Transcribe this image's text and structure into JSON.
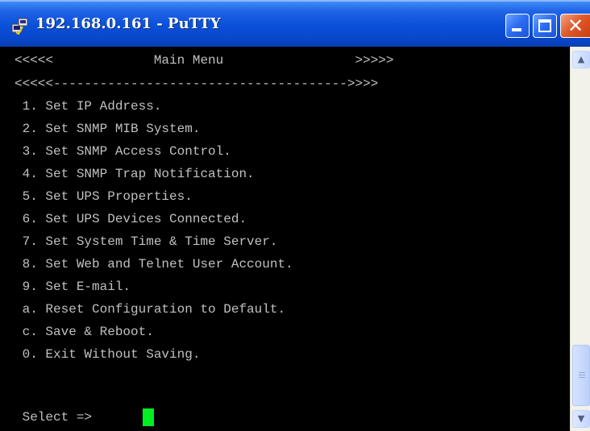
{
  "window": {
    "title": "192.168.0.161 - PuTTY",
    "icon": "putty-icon",
    "controls": {
      "minimize": "minimize-icon",
      "maximize": "maximize-icon",
      "close": "✕"
    }
  },
  "terminal": {
    "header": "<<<<<             Main Menu                 >>>>>",
    "separator": "<<<<<-------------------------------------->>>>",
    "menu": [
      " 1. Set IP Address.",
      " 2. Set SNMP MIB System.",
      " 3. Set SNMP Access Control.",
      " 4. Set SNMP Trap Notification.",
      " 5. Set UPS Properties.",
      " 6. Set UPS Devices Connected.",
      " 7. Set System Time & Time Server.",
      " 8. Set Web and Telnet User Account.",
      " 9. Set E-mail.",
      " a. Reset Configuration to Default.",
      " c. Save & Reboot.",
      " 0. Exit Without Saving."
    ],
    "prompt": " Select =>"
  },
  "colors": {
    "background": "#000000",
    "text": "#c0c0c0",
    "cursor": "#00ee22",
    "titlebar": "#0a4fd8"
  },
  "scrollbar": {
    "up": "▲",
    "down": "▼"
  }
}
